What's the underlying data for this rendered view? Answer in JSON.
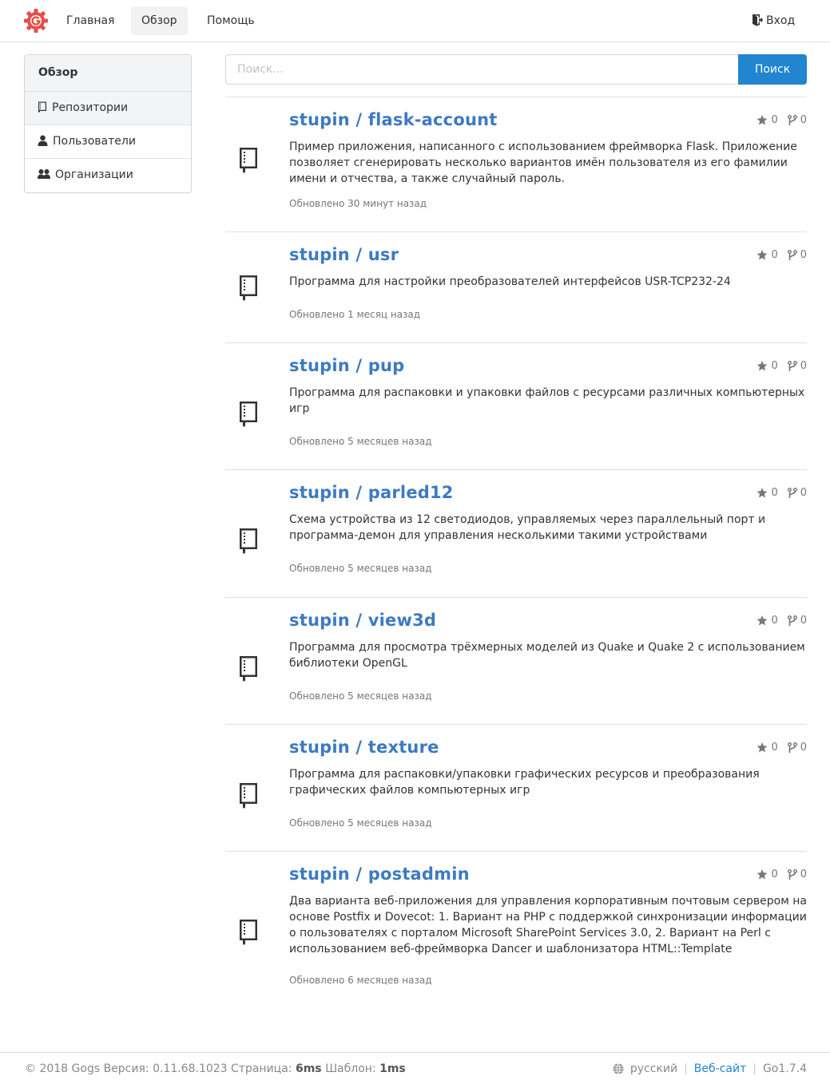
{
  "nav": {
    "home": "Главная",
    "explore": "Обзор",
    "help": "Помощь",
    "signin": "Вход"
  },
  "sidebar": {
    "title": "Обзор",
    "items": [
      {
        "label": "Репозитории",
        "icon": "repo-icon"
      },
      {
        "label": "Пользователи",
        "icon": "person-icon"
      },
      {
        "label": "Организации",
        "icon": "organization-icon"
      }
    ]
  },
  "search": {
    "placeholder": "Поиск...",
    "button": "Поиск"
  },
  "repos": [
    {
      "name": "stupin / flask-account",
      "stars": "0",
      "forks": "0",
      "description": "Пример приложения, написанного с использованием фреймворка Flask. Приложение позволяет сгенерировать несколько вариантов имён пользователя из его фамилии имени и отчества, а также случайный пароль.",
      "updated": "Обновлено 30 минут назад"
    },
    {
      "name": "stupin / usr",
      "stars": "0",
      "forks": "0",
      "description": "Программа для настройки преобразователей интерфейсов USR-TCP232-24",
      "updated": "Обновлено 1 месяц назад"
    },
    {
      "name": "stupin / pup",
      "stars": "0",
      "forks": "0",
      "description": "Программа для распаковки и упаковки файлов с ресурсами различных компьютерных игр",
      "updated": "Обновлено 5 месяцев назад"
    },
    {
      "name": "stupin / parled12",
      "stars": "0",
      "forks": "0",
      "description": "Схема устройства из 12 светодиодов, управляемых через параллельный порт и программа-демон для управления несколькими такими устройствами",
      "updated": "Обновлено 5 месяцев назад"
    },
    {
      "name": "stupin / view3d",
      "stars": "0",
      "forks": "0",
      "description": "Программа для просмотра трёхмерных моделей из Quake и Quake 2 с использованием библиотеки OpenGL",
      "updated": "Обновлено 5 месяцев назад"
    },
    {
      "name": "stupin / texture",
      "stars": "0",
      "forks": "0",
      "description": "Программа для распаковки/упаковки графических ресурсов и преобразования графических файлов компьютерных игр",
      "updated": "Обновлено 5 месяцев назад"
    },
    {
      "name": "stupin / postadmin",
      "stars": "0",
      "forks": "0",
      "description": "Два варианта веб-приложения для управления корпоративным почтовым сервером на основе Postfix и Dovecot: 1. Вариант на PHP с поддержкой синхронизации информации о пользователях с порталом Microsoft SharePoint Services 3.0, 2. Вариант на Perl с использованием веб-фреймворка Dancer и шаблонизатора HTML::Template",
      "updated": "Обновлено 6 месяцев назад"
    }
  ],
  "footer": {
    "copyright": "© 2018 Gogs Версия: 0.11.68.1023 Страница: ",
    "page_time": "6ms",
    "template_label": " Шаблон: ",
    "template_time": "1ms",
    "language": "русский",
    "website": "Веб-сайт",
    "go_version": "Go1.7.4"
  },
  "colors": {
    "accent": "#2185d0",
    "repo_link": "#3d7ac0",
    "logo": "#e0403e"
  }
}
